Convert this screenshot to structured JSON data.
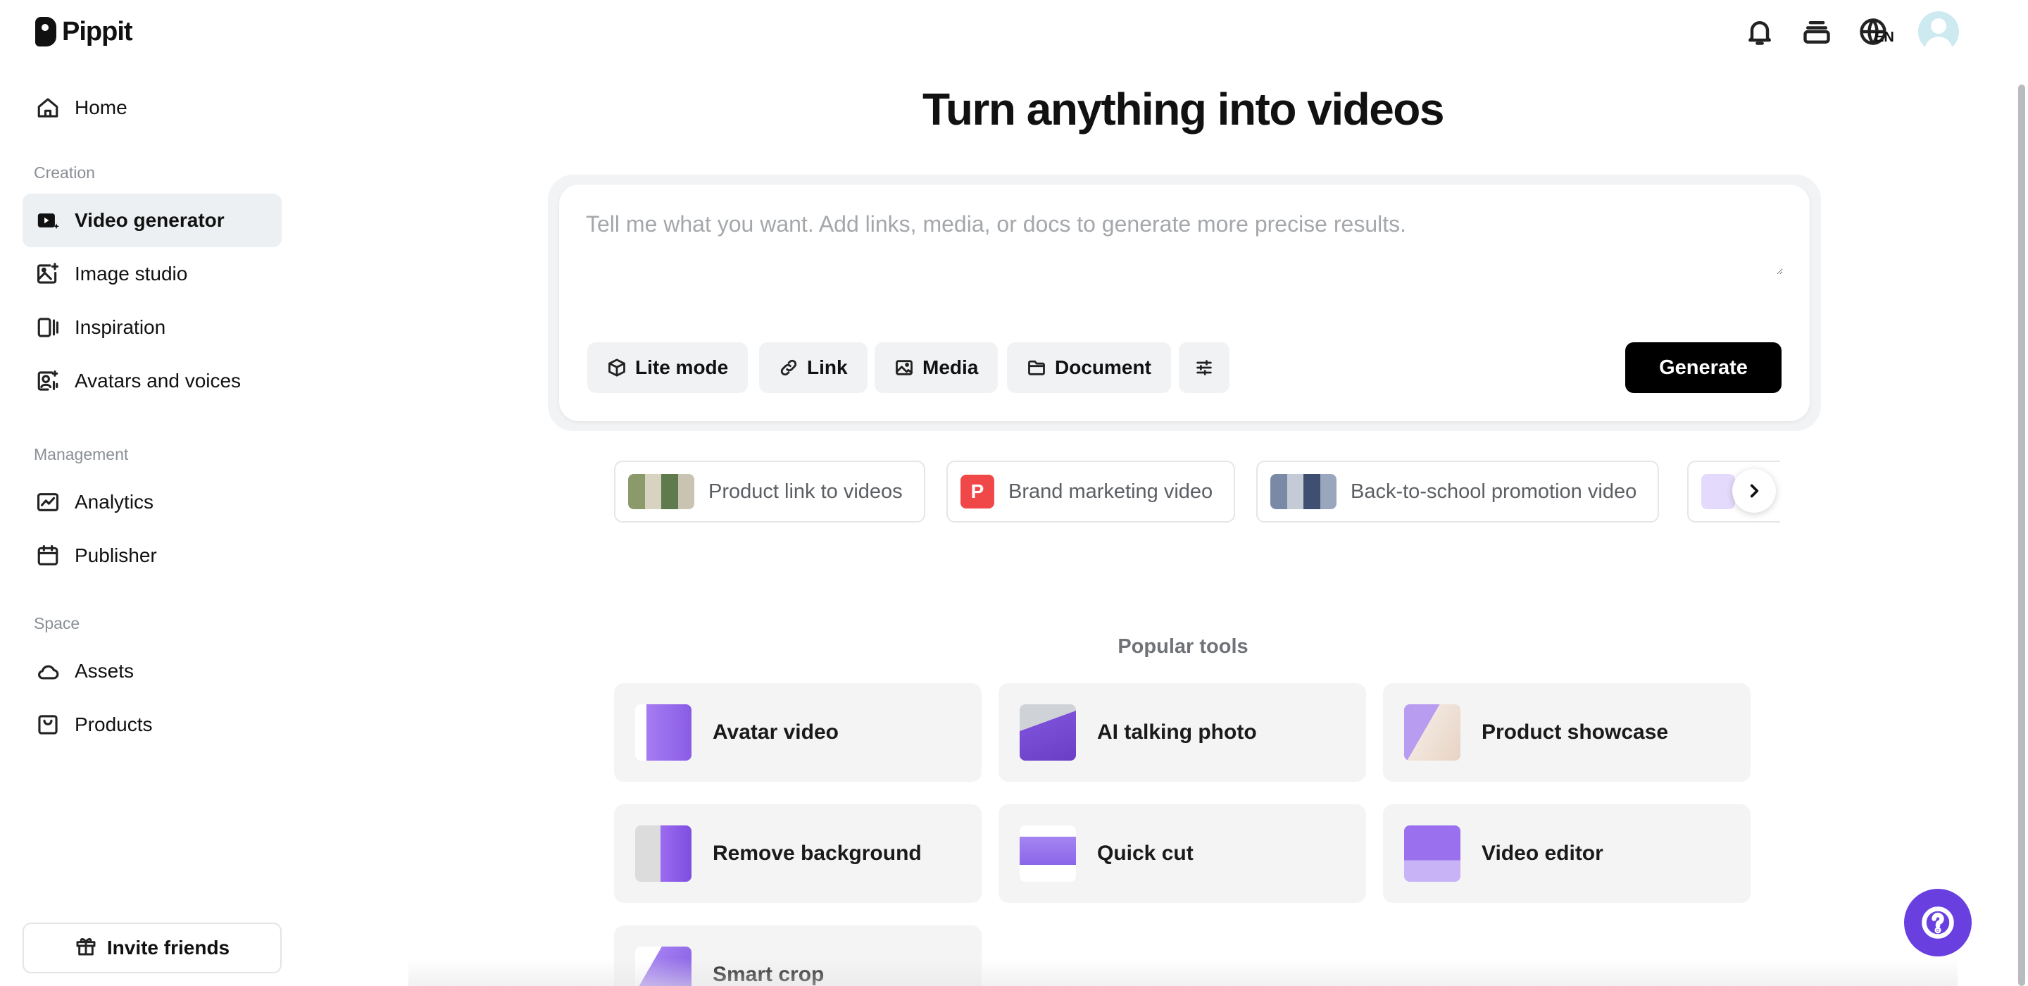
{
  "brand": {
    "name": "Pippit"
  },
  "sidebar": {
    "home": "Home",
    "sections": {
      "creation": "Creation",
      "management": "Management",
      "space": "Space"
    },
    "creation_items": [
      {
        "label": "Video generator",
        "icon": "video-generator-icon",
        "active": true
      },
      {
        "label": "Image studio",
        "icon": "image-studio-icon"
      },
      {
        "label": "Inspiration",
        "icon": "inspiration-icon"
      },
      {
        "label": "Avatars and voices",
        "icon": "avatar-voice-icon"
      }
    ],
    "management_items": [
      {
        "label": "Analytics",
        "icon": "analytics-icon"
      },
      {
        "label": "Publisher",
        "icon": "calendar-icon"
      }
    ],
    "space_items": [
      {
        "label": "Assets",
        "icon": "cloud-icon"
      },
      {
        "label": "Products",
        "icon": "bag-icon"
      }
    ],
    "invite": "Invite friends"
  },
  "header": {
    "language": "EN",
    "icons": [
      "bell-icon",
      "layers-icon",
      "globe-icon",
      "avatar"
    ]
  },
  "main": {
    "title": "Turn anything into videos",
    "prompt": {
      "placeholder": "Tell me what you want. Add links, media, or docs to generate more precise results.",
      "value": ""
    },
    "chips": {
      "lite": "Lite mode",
      "link": "Link",
      "media": "Media",
      "document": "Document"
    },
    "generate": "Generate",
    "suggestions": [
      {
        "label": "Product link to videos"
      },
      {
        "label": "Brand marketing video",
        "badge": "P"
      },
      {
        "label": "Back-to-school promotion video"
      }
    ],
    "popular_label": "Popular tools",
    "tools": [
      {
        "label": "Avatar video"
      },
      {
        "label": "AI talking photo"
      },
      {
        "label": "Product showcase"
      },
      {
        "label": "Remove background"
      },
      {
        "label": "Quick cut"
      },
      {
        "label": "Video editor"
      },
      {
        "label": "Smart crop"
      }
    ]
  },
  "colors": {
    "accent": "#6a3fe0",
    "active_nav_bg": "#ecf0f2",
    "generate_bg": "#000000",
    "badge_red": "#f04848"
  }
}
